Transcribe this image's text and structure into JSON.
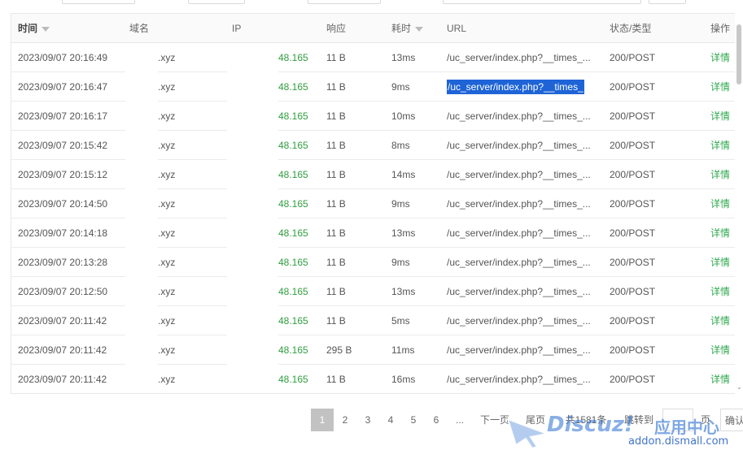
{
  "table": {
    "columns": [
      {
        "key": "time",
        "label": "时间",
        "sortable": true
      },
      {
        "key": "domain",
        "label": "域名",
        "sortable": false
      },
      {
        "key": "ip",
        "label": "IP",
        "sortable": false
      },
      {
        "key": "resp",
        "label": "响应",
        "sortable": false
      },
      {
        "key": "duration",
        "label": "耗时",
        "sortable": true
      },
      {
        "key": "url",
        "label": "URL",
        "sortable": false
      },
      {
        "key": "status",
        "label": "状态/类型",
        "sortable": false
      },
      {
        "key": "action",
        "label": "操作",
        "sortable": false
      }
    ],
    "rows": [
      {
        "time": "2023/09/07 20:16:49",
        "domain": ".xyz",
        "ip": "48.165",
        "resp": "11 B",
        "duration": "13ms",
        "url": "/uc_server/index.php?__times_...",
        "status": "200/POST",
        "action": "详情"
      },
      {
        "time": "2023/09/07 20:16:47",
        "domain": ".xyz",
        "ip": "48.165",
        "resp": "11 B",
        "duration": "9ms",
        "url": "/uc_server/index.php?__times_",
        "status": "200/POST",
        "action": "详情",
        "selected": true
      },
      {
        "time": "2023/09/07 20:16:17",
        "domain": ".xyz",
        "ip": "48.165",
        "resp": "11 B",
        "duration": "10ms",
        "url": "/uc_server/index.php?__times_...",
        "status": "200/POST",
        "action": "详情"
      },
      {
        "time": "2023/09/07 20:15:42",
        "domain": ".xyz",
        "ip": "48.165",
        "resp": "11 B",
        "duration": "8ms",
        "url": "/uc_server/index.php?__times_...",
        "status": "200/POST",
        "action": "详情"
      },
      {
        "time": "2023/09/07 20:15:12",
        "domain": ".xyz",
        "ip": "48.165",
        "resp": "11 B",
        "duration": "14ms",
        "url": "/uc_server/index.php?__times_...",
        "status": "200/POST",
        "action": "详情"
      },
      {
        "time": "2023/09/07 20:14:50",
        "domain": ".xyz",
        "ip": "48.165",
        "resp": "11 B",
        "duration": "9ms",
        "url": "/uc_server/index.php?__times_...",
        "status": "200/POST",
        "action": "详情"
      },
      {
        "time": "2023/09/07 20:14:18",
        "domain": ".xyz",
        "ip": "48.165",
        "resp": "11 B",
        "duration": "13ms",
        "url": "/uc_server/index.php?__times_...",
        "status": "200/POST",
        "action": "详情"
      },
      {
        "time": "2023/09/07 20:13:28",
        "domain": ".xyz",
        "ip": "48.165",
        "resp": "11 B",
        "duration": "9ms",
        "url": "/uc_server/index.php?__times_...",
        "status": "200/POST",
        "action": "详情"
      },
      {
        "time": "2023/09/07 20:12:50",
        "domain": ".xyz",
        "ip": "48.165",
        "resp": "11 B",
        "duration": "13ms",
        "url": "/uc_server/index.php?__times_...",
        "status": "200/POST",
        "action": "详情"
      },
      {
        "time": "2023/09/07 20:11:42",
        "domain": ".xyz",
        "ip": "48.165",
        "resp": "11 B",
        "duration": "5ms",
        "url": "/uc_server/index.php?__times_...",
        "status": "200/POST",
        "action": "详情"
      },
      {
        "time": "2023/09/07 20:11:42",
        "domain": ".xyz",
        "ip": "48.165",
        "resp": "295 B",
        "duration": "11ms",
        "url": "/uc_server/index.php?__times_...",
        "status": "200/POST",
        "action": "详情"
      },
      {
        "time": "2023/09/07 20:11:42",
        "domain": ".xyz",
        "ip": "48.165",
        "resp": "11 B",
        "duration": "16ms",
        "url": "/uc_server/index.php?__times_...",
        "status": "200/POST",
        "action": "详情"
      }
    ]
  },
  "pagination": {
    "current": "1",
    "pages": [
      "1",
      "2",
      "3",
      "4",
      "5",
      "6"
    ],
    "ellipsis": "...",
    "next": "下一页",
    "last": "尾页",
    "total": "共1581条",
    "jump": "跳转到",
    "page_unit": "页",
    "confirm": "确认"
  },
  "watermark": {
    "brand": "Discuz!",
    "subtitle": "应用中心",
    "url": "addon.dismall.com"
  },
  "colors": {
    "accent_green": "#2fa84f",
    "ip_green": "#2f9e3f",
    "selection_blue": "#1e64d6",
    "active_page": "#c2c2c2"
  }
}
